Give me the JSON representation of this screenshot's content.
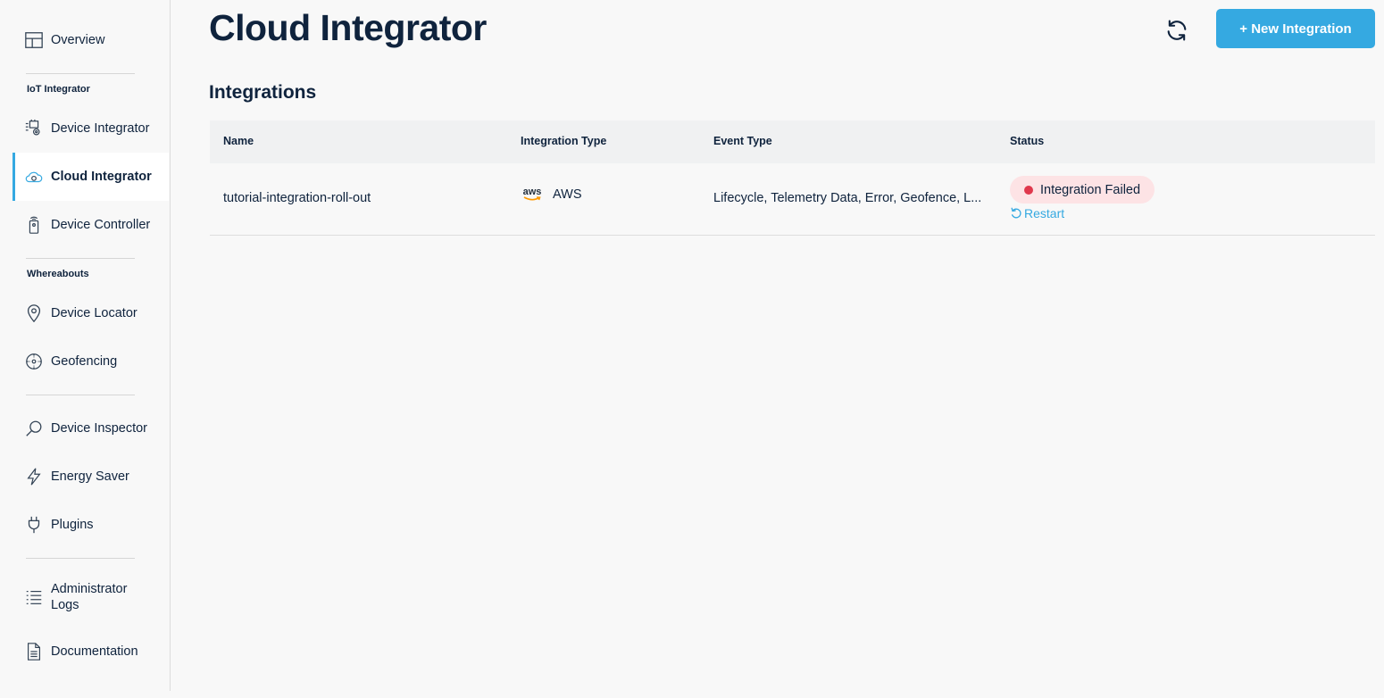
{
  "sidebar": {
    "overview": "Overview",
    "iot_section": "IoT Integrator",
    "device_integrator": "Device Integrator",
    "cloud_integrator": "Cloud Integrator",
    "device_controller": "Device Controller",
    "whereabouts_section": "Whereabouts",
    "device_locator": "Device Locator",
    "geofencing": "Geofencing",
    "device_inspector": "Device Inspector",
    "energy_saver": "Energy Saver",
    "plugins": "Plugins",
    "admin_logs_line1": "Administrator",
    "admin_logs_line2": "Logs",
    "documentation": "Documentation"
  },
  "header": {
    "title": "Cloud Integrator",
    "new_button": "+ New Integration",
    "accent": "#35a9e1"
  },
  "integrations": {
    "title": "Integrations",
    "columns": [
      "Name",
      "Integration Type",
      "Event Type",
      "Status"
    ],
    "rows": [
      {
        "name": "tutorial-integration-roll-out",
        "type_logo": "aws",
        "type": "AWS",
        "event_type": "Lifecycle, Telemetry Data, Error, Geofence, L...",
        "status": "Integration Failed",
        "status_color": "#e0384d",
        "action": "Restart"
      }
    ]
  }
}
